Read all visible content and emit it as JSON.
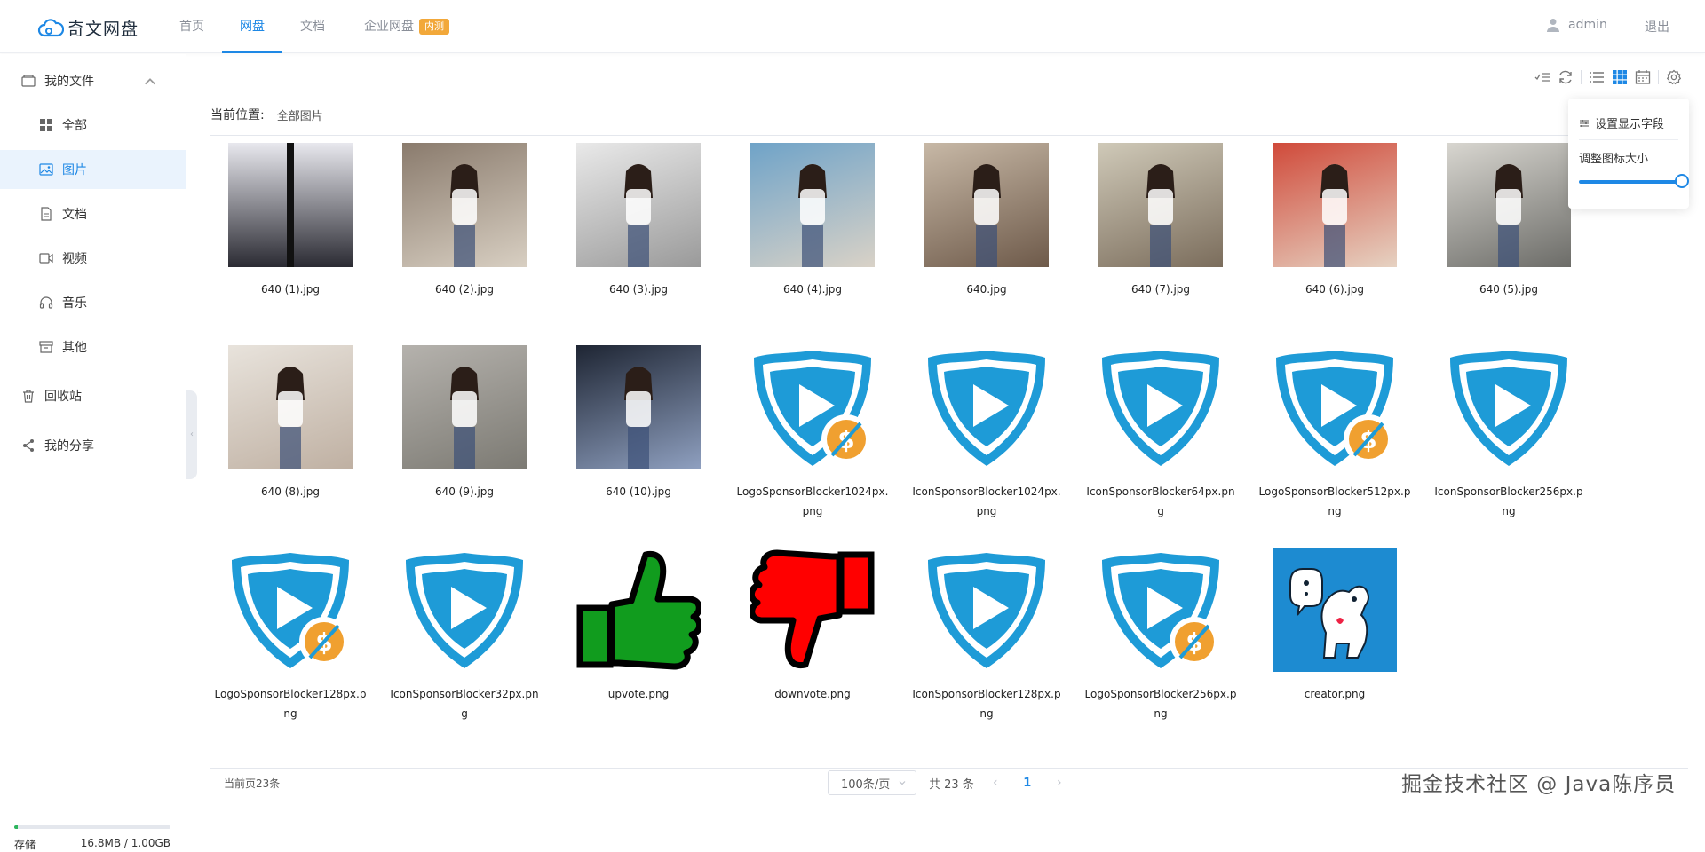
{
  "app": {
    "name": "奇文网盘"
  },
  "nav": {
    "tabs": [
      "首页",
      "网盘",
      "文档",
      "企业网盘"
    ],
    "enterprise_badge": "内测",
    "user": "admin",
    "logout": "退出"
  },
  "sidebar": {
    "my_files": "我的文件",
    "items": [
      "全部",
      "图片",
      "文档",
      "视频",
      "音乐",
      "其他"
    ],
    "recycle": "回收站",
    "share": "我的分享",
    "storage_label": "存储",
    "storage_value": "16.8MB / 1.00GB",
    "storage_fraction": 0.0164
  },
  "breadcrumb": {
    "label": "当前位置:",
    "value": "全部图片"
  },
  "popover": {
    "fields": "设置显示字段",
    "icon_size": "调整图标大小",
    "icon_size_level": 1.0
  },
  "files": [
    {
      "name": "640 (1).jpg",
      "kind": "photo-double"
    },
    {
      "name": "640 (2).jpg",
      "kind": "photo"
    },
    {
      "name": "640 (3).jpg",
      "kind": "photo"
    },
    {
      "name": "640 (4).jpg",
      "kind": "photo"
    },
    {
      "name": "640.jpg",
      "kind": "photo"
    },
    {
      "name": "640 (7).jpg",
      "kind": "photo"
    },
    {
      "name": "640 (6).jpg",
      "kind": "photo"
    },
    {
      "name": "640 (5).jpg",
      "kind": "photo"
    },
    {
      "name": "640 (8).jpg",
      "kind": "photo"
    },
    {
      "name": "640 (9).jpg",
      "kind": "photo"
    },
    {
      "name": "640 (10).jpg",
      "kind": "photo"
    },
    {
      "name": "LogoSponsorBlocker1024px.png",
      "kind": "shield-coin"
    },
    {
      "name": "IconSponsorBlocker1024px.png",
      "kind": "shield"
    },
    {
      "name": "IconSponsorBlocker64px.png",
      "kind": "shield"
    },
    {
      "name": "LogoSponsorBlocker512px.png",
      "kind": "shield-coin"
    },
    {
      "name": "IconSponsorBlocker256px.png",
      "kind": "shield"
    },
    {
      "name": "LogoSponsorBlocker128px.png",
      "kind": "shield-coin"
    },
    {
      "name": "IconSponsorBlocker32px.png",
      "kind": "shield"
    },
    {
      "name": "upvote.png",
      "kind": "upvote"
    },
    {
      "name": "downvote.png",
      "kind": "downvote"
    },
    {
      "name": "IconSponsorBlocker128px.png",
      "kind": "shield"
    },
    {
      "name": "LogoSponsorBlocker256px.png",
      "kind": "shield-coin"
    },
    {
      "name": "creator.png",
      "kind": "creator"
    }
  ],
  "footer": {
    "current_count": "当前页23条",
    "page_size": "100条/页",
    "total": "共 23 条",
    "page": "1"
  },
  "watermark": "掘金技术社区 @ Java陈序员",
  "colors": {
    "accent": "#1e88e5",
    "badge": "#f2a83a",
    "shield_blue": "#1e9bd7",
    "coin_orange": "#f0a030"
  }
}
